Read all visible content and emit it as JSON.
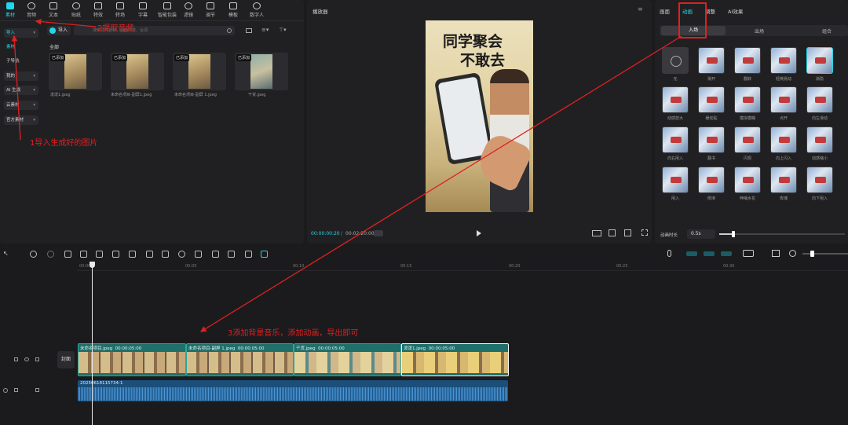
{
  "toolbar": {
    "items": [
      "素材",
      "音频",
      "文本",
      "贴纸",
      "特效",
      "转场",
      "字幕",
      "智能包装",
      "滤镜",
      "调节",
      "模板",
      "数字人"
    ]
  },
  "sidebar": {
    "items": [
      "导入",
      "素材",
      "子导航",
      "我的",
      "AI 生成",
      "云素材",
      "官方素材"
    ]
  },
  "media": {
    "import_label": "导入",
    "search_placeholder": "搜索文件名称、画面内容、台词",
    "section_all": "全部",
    "tag_added": "已添加",
    "files": [
      "泼泼1.jpeg",
      "未命名项目-副屏1.jpeg",
      "未命名项目-副屏 1.jpeg",
      "干货.jpeg"
    ]
  },
  "player": {
    "title": "播放器",
    "time_current": "00:00:00:20",
    "time_total": "00:02:20:00",
    "poster_title_1": "同学聚会",
    "poster_title_2": "不敢去"
  },
  "right_panel": {
    "tabs": [
      "画面",
      "动画",
      "调整",
      "AI效果"
    ],
    "subtabs": [
      "入场",
      "出场",
      "组合"
    ],
    "animations": [
      "无",
      "渐开",
      "翻转",
      "轻微晃动",
      "渐隐",
      "动感放大",
      "缓动贴",
      "模拟模糊",
      "点开",
      "向左滑动",
      "向右甩入",
      "翻书",
      "闪现",
      "向上闪入",
      "动感缩小",
      "甩入",
      "侧滑",
      "伸缩水花",
      "玫瑰",
      "向下甩入"
    ],
    "duration_label": "动画时长",
    "duration_value": "0.5s"
  },
  "timeline": {
    "ticks": [
      "00:00",
      "00:05",
      "00:10",
      "00:15",
      "00:20",
      "00:25",
      "00:30"
    ],
    "cover_label": "封面",
    "clips": [
      {
        "name": "未命名项目.jpeg",
        "dur": "00:00:05:00"
      },
      {
        "name": "未命名项目-副屏 1.jpeg",
        "dur": "00:00:05:00"
      },
      {
        "name": "干货.jpeg",
        "dur": "00:00:05:00"
      },
      {
        "name": "泼泼1.jpeg",
        "dur": "00:00:05:00"
      }
    ],
    "audio_name": "20250618115734-1"
  },
  "annotations": {
    "step1": "1导入生成好的图片",
    "step2": "2提取音频",
    "step3": "3添加背景音乐，添加动画，导出即可"
  },
  "colors": {
    "accent": "#24d6e8",
    "annotation": "#e02020"
  }
}
